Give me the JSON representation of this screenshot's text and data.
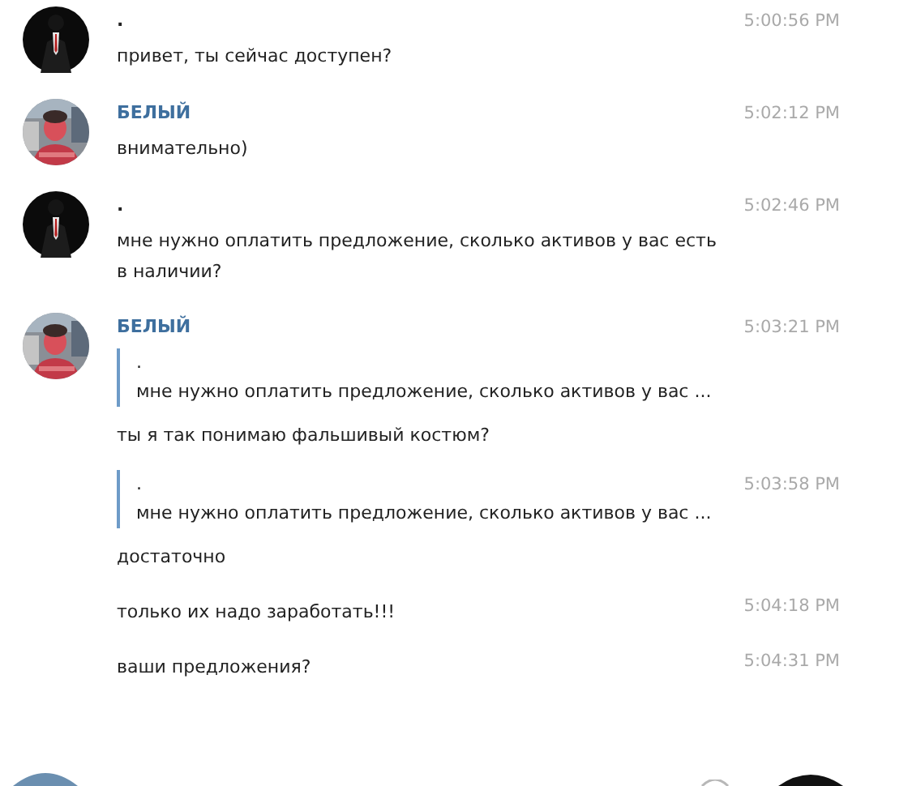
{
  "messages": [
    {
      "author": {
        "name": ".",
        "avatar": {
          "kind": "dark"
        },
        "highlighted": false
      },
      "time": "5:00:56 PM",
      "text": "привет, ты сейчас доступен?"
    },
    {
      "author": {
        "name": "БЕЛЫЙ",
        "highlighted": true
      },
      "time": "5:02:12 PM",
      "text": "внимательно)"
    },
    {
      "author": {
        "name": ".",
        "avatar": {
          "kind": "dark"
        },
        "highlighted": false
      },
      "time": "5:02:46 PM",
      "text": "мне нужно оплатить предложение, сколько активов у вас есть в наличии?"
    },
    {
      "author": {
        "name": "БЕЛЫЙ",
        "highlighted": true
      },
      "time": "5:03:21 PM",
      "reply": {
        "name": ".",
        "text": "мне нужно оплатить предложение, сколько активов у вас ..."
      },
      "text": "ты я так понимаю фальшивый костюм?"
    },
    {
      "time": "5:03:58 PM",
      "reply": {
        "name": ".",
        "text": "мне нужно оплатить предложение, сколько активов у вас ..."
      },
      "text": "достаточно"
    },
    {
      "time": "5:04:18 PM",
      "text": "только их надо заработать!!!"
    },
    {
      "time": "5:04:31 PM",
      "text": "ваши предложения?"
    }
  ]
}
